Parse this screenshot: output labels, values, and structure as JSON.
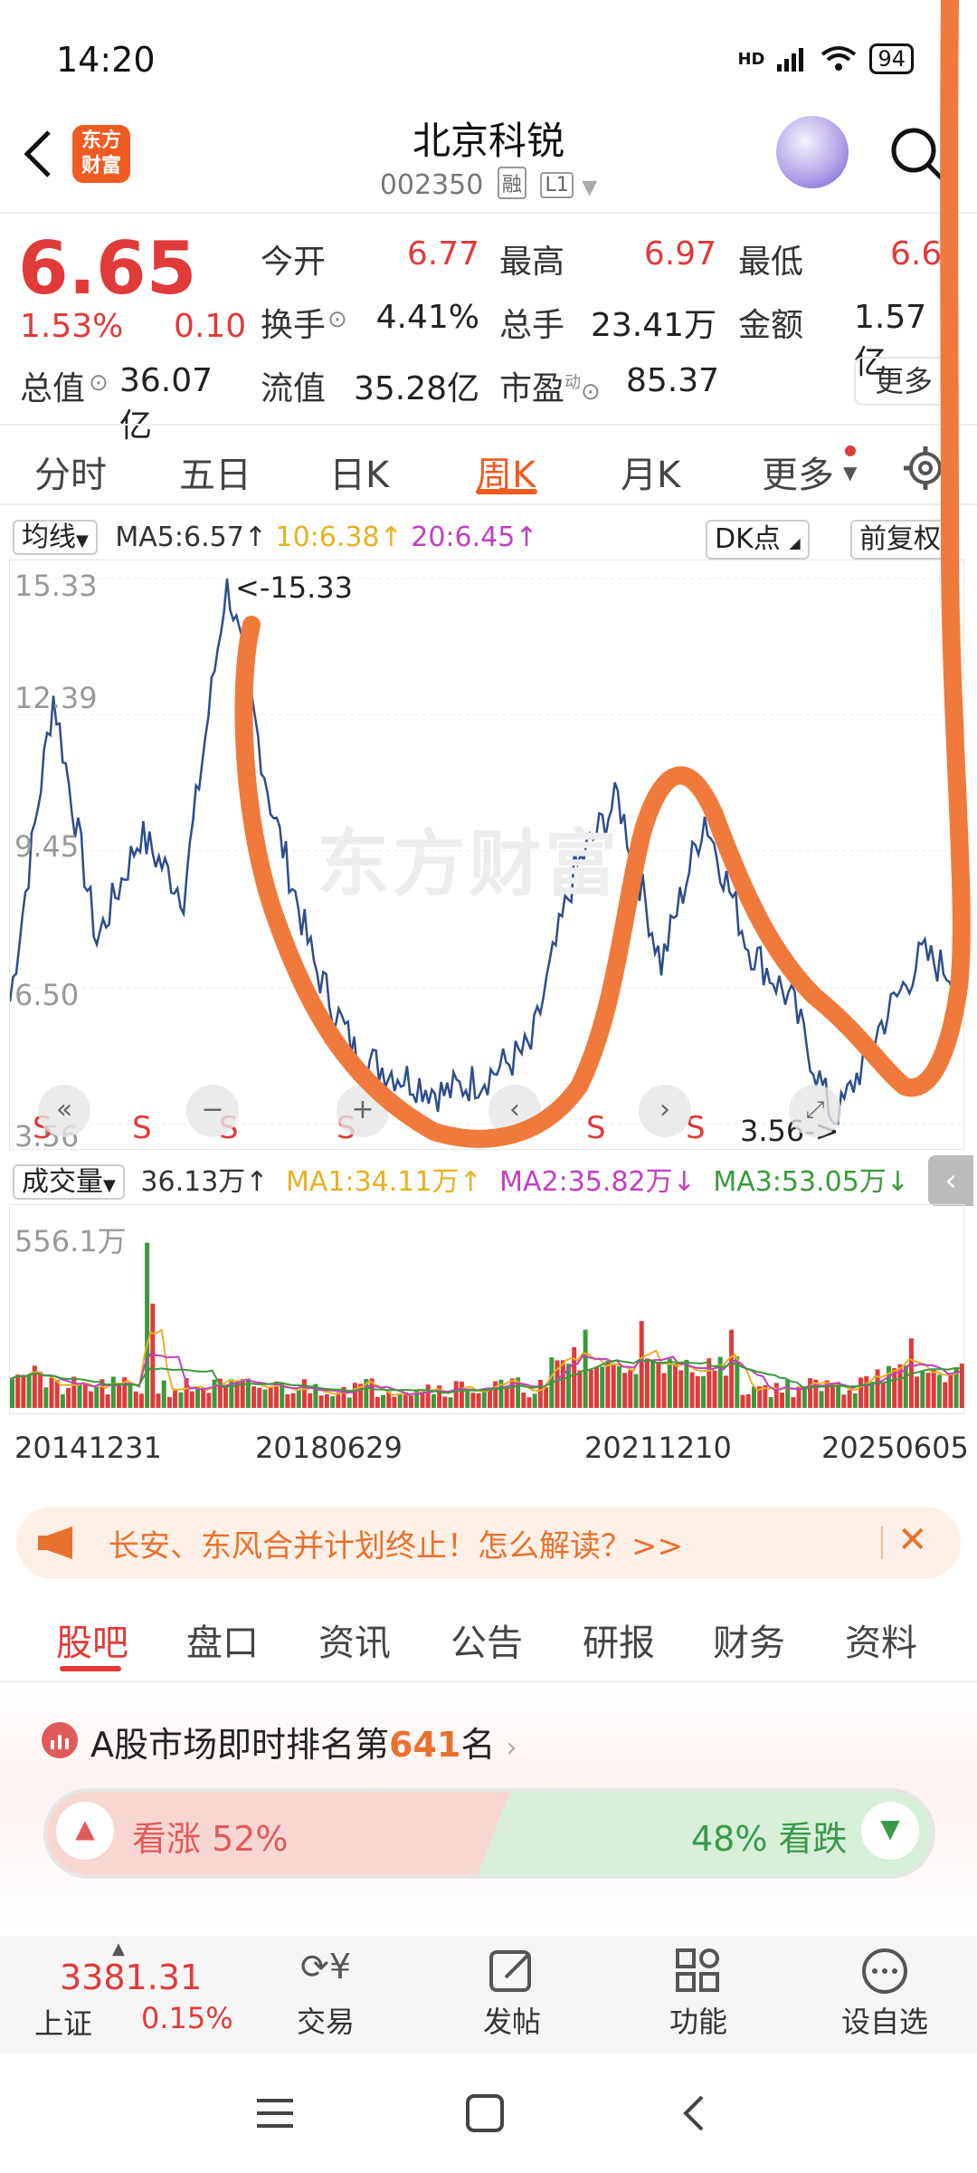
{
  "status": {
    "time": "14:20",
    "battery": "94",
    "network": "HD"
  },
  "header": {
    "logo_line1": "东方",
    "logo_line2": "财富",
    "stock_name": "北京科锐",
    "stock_code": "002350",
    "tag1": "融",
    "tag2": "L1"
  },
  "quote": {
    "price": "6.65",
    "change_pct": "1.53%",
    "change": "0.10",
    "open_label": "今开",
    "open": "6.77",
    "high_label": "最高",
    "high": "6.97",
    "low_label": "最低",
    "low": "6.6",
    "turnover_label": "换手",
    "turnover": "4.41%",
    "volume_label": "总手",
    "volume": "23.41万",
    "amount_label": "金额",
    "amount": "1.57亿",
    "mktcap_label": "总值",
    "mktcap": "36.07亿",
    "float_label": "流值",
    "float_cap": "35.28亿",
    "pe_label": "市盈",
    "pe_sup": "动",
    "pe": "85.37",
    "more": "更多"
  },
  "period_tabs": [
    "分时",
    "五日",
    "日K",
    "周K",
    "月K",
    "更多"
  ],
  "ma_bar": {
    "dropdown": "均线",
    "ma5": "MA5:6.57",
    "ma10": "10:6.38",
    "ma20": "20:6.45",
    "dk": "DK点",
    "adjust": "前复权"
  },
  "price_chart": {
    "axis": [
      "15.33",
      "12.39",
      "9.45",
      "6.50",
      "3.56"
    ],
    "high_marker": "<-15.33",
    "low_marker": "3.56->",
    "s_marker": "S",
    "watermark": "东方财富"
  },
  "volume_bar": {
    "dropdown": "成交量",
    "vol": "36.13万",
    "ma1": "MA1:34.11万",
    "ma2": "MA2:35.82万",
    "ma3": "MA3:53.05万",
    "axis_max": "556.1万"
  },
  "dates": [
    "20141231",
    "20180629",
    "20211210",
    "20250605"
  ],
  "banner": {
    "text": "长安、东风合并计划终止！怎么解读？>>"
  },
  "info_tabs": [
    "股吧",
    "盘口",
    "资讯",
    "公告",
    "研报",
    "财务",
    "资料"
  ],
  "ranking": {
    "prefix": "A股市场即时排名第",
    "rank": "641",
    "suffix": "名"
  },
  "vote": {
    "up": "看涨 52%",
    "down": "48% 看跌"
  },
  "bottom_nav": {
    "index_value": "3381.31",
    "index_name": "上证",
    "index_change": "0.15%",
    "trade": "交易",
    "post": "发帖",
    "functions": "功能",
    "watchlist": "设自选"
  },
  "chart_data": {
    "type": "line",
    "title": "",
    "ylabel": "",
    "ylim": [
      3.56,
      15.33
    ],
    "x": [
      "20141231",
      "20180629",
      "20211210",
      "20250605"
    ],
    "series": [
      {
        "values": [
          6.2,
          12.8,
          7.5,
          9.8,
          8.5,
          15.33,
          10.5,
          7.0,
          5.0,
          4.6,
          4.2,
          4.6,
          5.2,
          9.0,
          10.6,
          7.0,
          10.2,
          7.4,
          6.2,
          3.56,
          5.6,
          7.2,
          6.65
        ]
      }
    ],
    "volume": {
      "type": "bar",
      "ylim": [
        0,
        556.1
      ],
      "unit": "万"
    },
    "colors": {
      "up": "#e13a3a",
      "line": "#2e4d8c",
      "annotation": "#ef7a3c"
    }
  }
}
